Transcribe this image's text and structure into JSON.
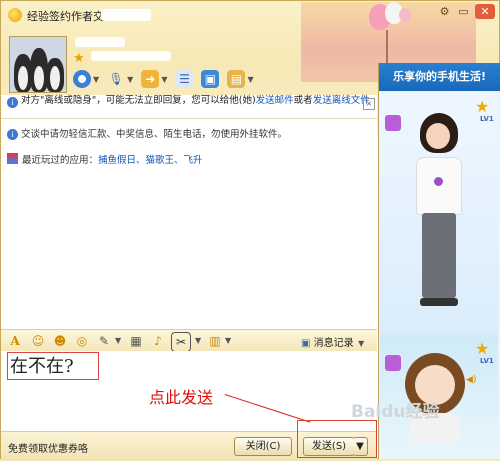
{
  "window": {
    "title": "经验签约作者交",
    "controls": {
      "restore": "▭",
      "close": "✕"
    }
  },
  "notice": {
    "text_before": "对方\"离线或隐身\"，可能无法立即回复，您可以给他(她)",
    "link_email": "发送邮件",
    "text_mid": "或者",
    "link_offline": "发送离线文件"
  },
  "chat": {
    "safety_text": "交谈中请勿轻信汇款、中奖信息、陌生电话，勿使用外挂软件。",
    "recent_apps_label": "最近玩过的应用：",
    "recent_apps": "捕鱼假日、猫歌王、飞升"
  },
  "input_toolbar": {
    "message_log": "消息记录"
  },
  "input": {
    "typed_text": "在不在?"
  },
  "annotation": {
    "text": "点此发送"
  },
  "bottom": {
    "coupon": "免费领取优惠券咯",
    "close_button": "关闭(C)",
    "send_button": "发送(S)"
  },
  "sidebar": {
    "slogan": "乐享你的手机生活!",
    "level_badge": "LV1",
    "level_badge_2": "LV1"
  },
  "watermark": "Baidu经验",
  "colors": {
    "accent": "#1455b5",
    "annotation_red": "#e01010",
    "frame": "#c9a85a"
  }
}
